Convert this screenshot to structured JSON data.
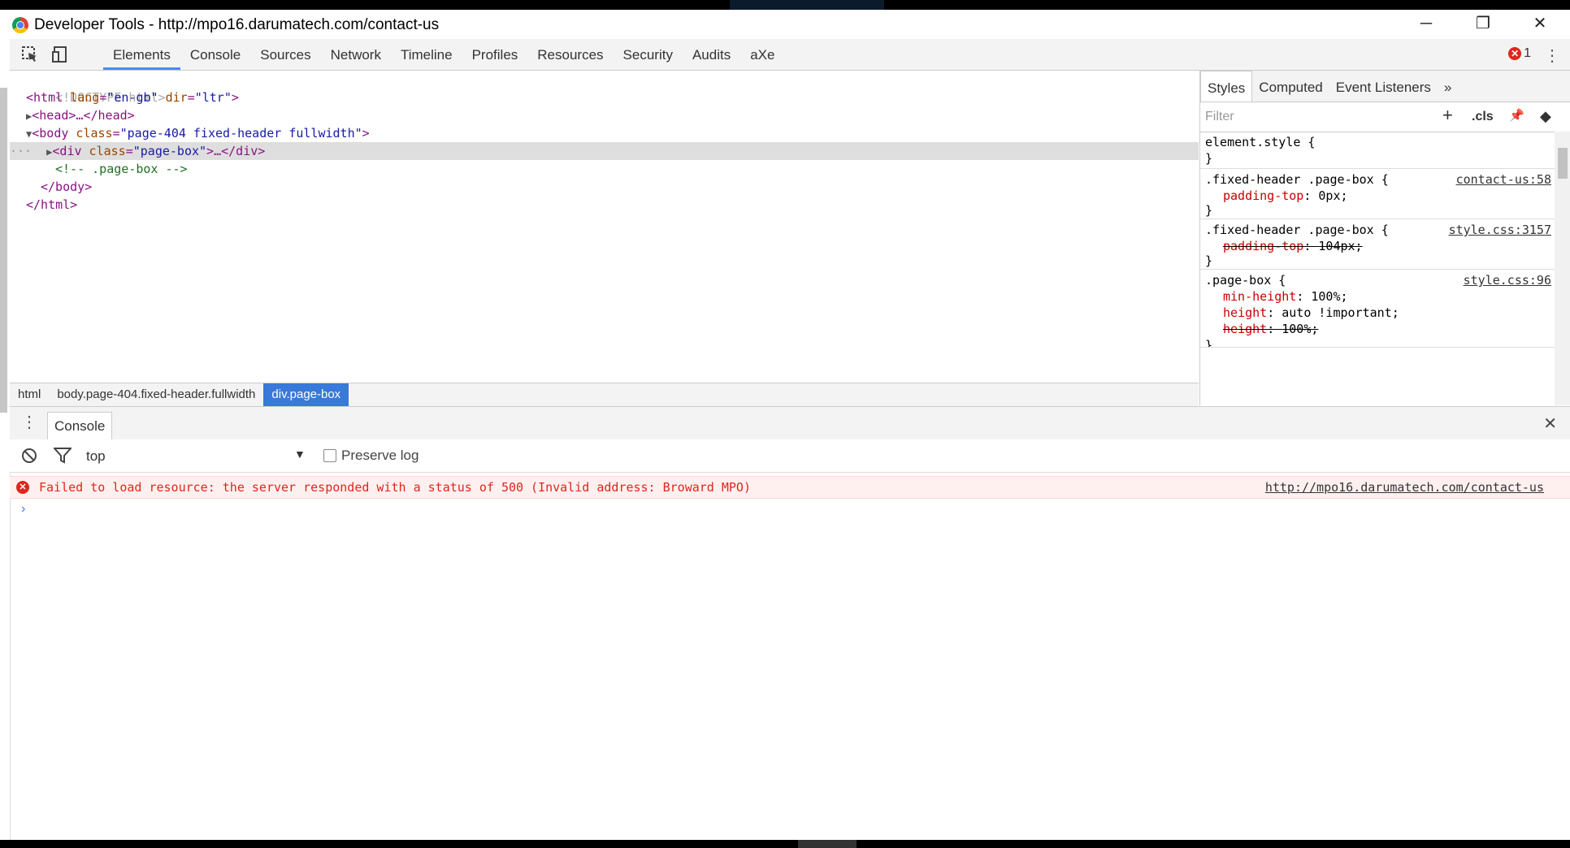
{
  "window": {
    "title": "Developer Tools - http://mpo16.darumatech.com/contact-us",
    "minimize": "─",
    "restore": "❐",
    "close": "✕"
  },
  "toolbar": {
    "tabs": [
      "Elements",
      "Console",
      "Sources",
      "Network",
      "Timeline",
      "Profiles",
      "Resources",
      "Security",
      "Audits",
      "aXe"
    ],
    "active_tab": "Elements",
    "error_count": "1",
    "error_glyph": "✕",
    "menu_glyph": "⋮"
  },
  "dom": {
    "doctype": "<!DOCTYPE html>",
    "html_open": "<html lang=\"en-gb\" dir=\"ltr\">",
    "html_tag": "html",
    "html_lang_attr": "lang",
    "html_lang_val": "\"en-gb\"",
    "html_dir_attr": "dir",
    "html_dir_val": "\"ltr\"",
    "head_collapsed": "<head>…</head>",
    "body_tag": "body",
    "body_class_attr": "class",
    "body_class_val": "\"page-404 fixed-header fullwidth\"",
    "div_tag": "div",
    "div_class_attr": "class",
    "div_class_val": "\"page-box\"",
    "div_close": ">…</div>",
    "comment": "<!-- .page-box -->",
    "body_close": "</body>",
    "html_close": "</html>",
    "selected_marker": "···",
    "eq": "=",
    "lt": "<",
    "gt": ">",
    "sp": " "
  },
  "breadcrumbs": [
    "html",
    "body.page-404.fixed-header.fullwidth",
    "div.page-box"
  ],
  "styles_panel": {
    "tabs": [
      "Styles",
      "Computed",
      "Event Listeners"
    ],
    "more_glyph": "»",
    "filter_placeholder": "Filter",
    "add_glyph": "+",
    "cls_label": ".cls",
    "pin_glyph": "📌",
    "diamond_glyph": "◆",
    "rules": [
      {
        "selector": "element.style {",
        "source": "",
        "decls": [],
        "close": "}"
      },
      {
        "selector": ".fixed-header .page-box {",
        "source": "contact-us:58",
        "decls": [
          {
            "prop": "padding-top",
            "value": "0px;",
            "overridden": false
          }
        ],
        "close": "}"
      },
      {
        "selector": ".fixed-header .page-box {",
        "source": "style.css:3157",
        "decls": [
          {
            "prop": "padding-top",
            "value": "104px;",
            "overridden": true
          }
        ],
        "close": "}"
      },
      {
        "selector": ".page-box {",
        "source": "style.css:96",
        "decls": [
          {
            "prop": "min-height",
            "value": "100%;",
            "overridden": false
          },
          {
            "prop": "height",
            "value": "auto !important;",
            "overridden": false
          },
          {
            "prop": "height",
            "value": "100%;",
            "overridden": true
          }
        ],
        "close": "}"
      }
    ]
  },
  "drawer": {
    "menu_glyph": "⋮",
    "tab": "Console",
    "close_glyph": "✕"
  },
  "console": {
    "context": "top",
    "dropdown_glyph": "▼",
    "preserve_log_label": "Preserve log",
    "error_message": "Failed to load resource: the server responded with a status of 500 (Invalid address: Broward MPO)",
    "error_url": "http://mpo16.darumatech.com/contact-us",
    "prompt_glyph": "›"
  },
  "colors": {
    "accent": "#3879d9",
    "error": "#e0251b",
    "tag": "#881280",
    "attr": "#994500",
    "value": "#1a1aa6",
    "comment": "#236e25"
  }
}
